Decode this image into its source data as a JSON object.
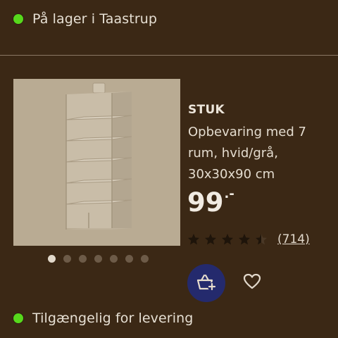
{
  "stock_status": {
    "text": "På lager i Taastrup",
    "color": "#57d81c",
    "icon": "status-dot-icon"
  },
  "product": {
    "image_alt": "STUK hanging organizer",
    "brand": "STUK",
    "description_lines": [
      "Opbevaring med 7",
      "rum, hvid/grå,",
      "30x30x90 cm"
    ],
    "price": {
      "integer": "99",
      "decimal": ".-"
    },
    "rating": {
      "stars": 4.5,
      "max_stars": 5,
      "review_count": "(714)"
    }
  },
  "gallery": {
    "count": 7,
    "active_index": 0
  },
  "actions": {
    "add_to_cart_icon": "basket-plus-icon",
    "favourite_icon": "heart-icon",
    "add_to_cart_color": "#242a6d"
  },
  "delivery_status": {
    "text": "Tilgængelig for levering",
    "color": "#57d81c",
    "icon": "status-dot-icon"
  }
}
